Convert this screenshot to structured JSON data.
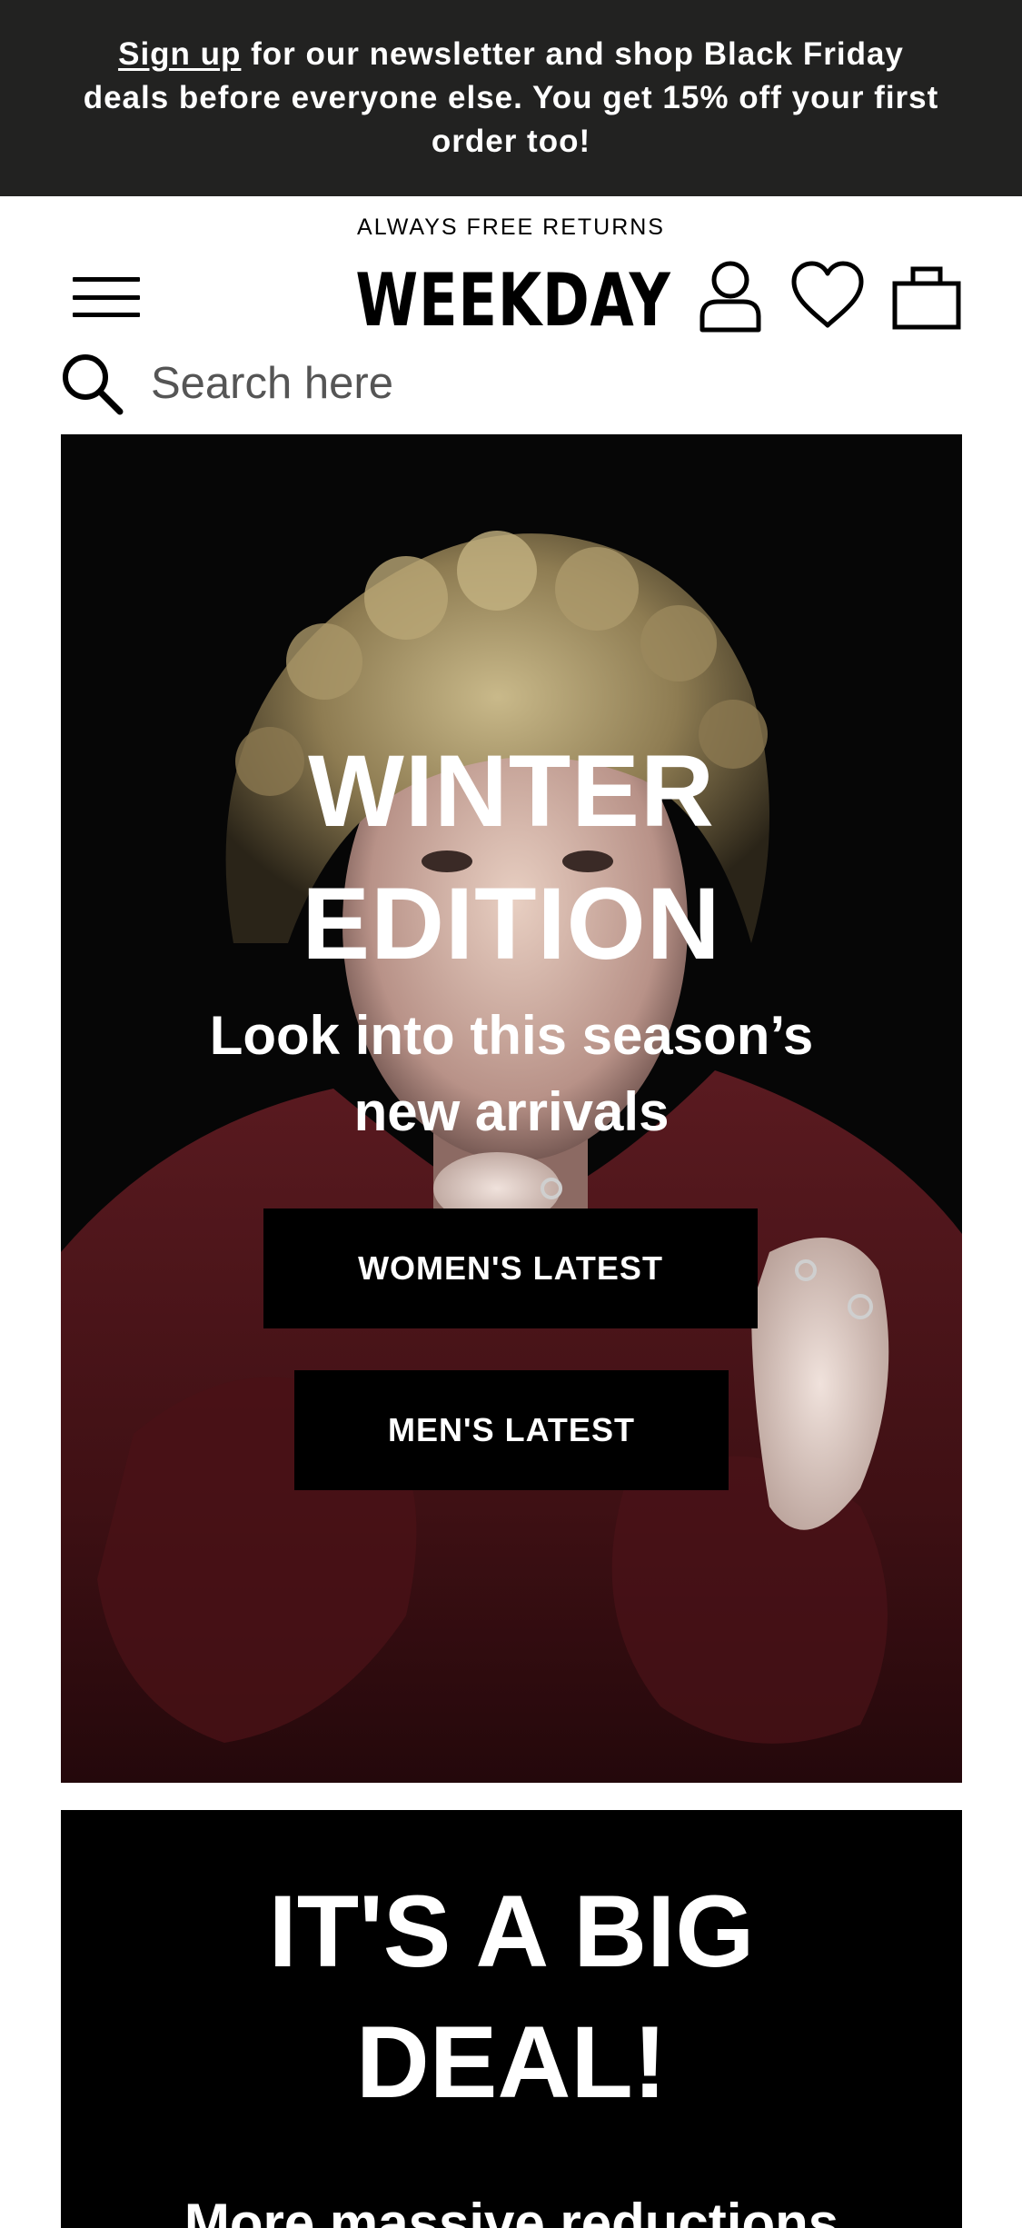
{
  "banner": {
    "link_text": "Sign up",
    "text": " for our newsletter and shop Black Friday deals before everyone else. You get 15% off your first order too!"
  },
  "header": {
    "returns_note": "ALWAYS FREE RETURNS",
    "logo": "WEEKDAY",
    "icons": [
      "menu-icon",
      "account-icon",
      "heart-icon",
      "bag-icon"
    ]
  },
  "search": {
    "placeholder": "Search here",
    "icon": "search-icon"
  },
  "hero": {
    "title_line1": "WINTER",
    "title_line2": "EDITION",
    "subtitle_line1": "Look into this season’s",
    "subtitle_line2": "new arrivals",
    "womens_button": "WOMEN'S LATEST",
    "mens_button": "MEN'S LATEST"
  },
  "deal": {
    "title_line1": "IT'S A BIG",
    "title_line2": "DEAL!",
    "subtitle": "More massive reductions"
  },
  "colors": {
    "banner_bg": "#222221",
    "text_dark": "#000000",
    "text_light": "#ffffff",
    "button_bg": "#000000"
  }
}
